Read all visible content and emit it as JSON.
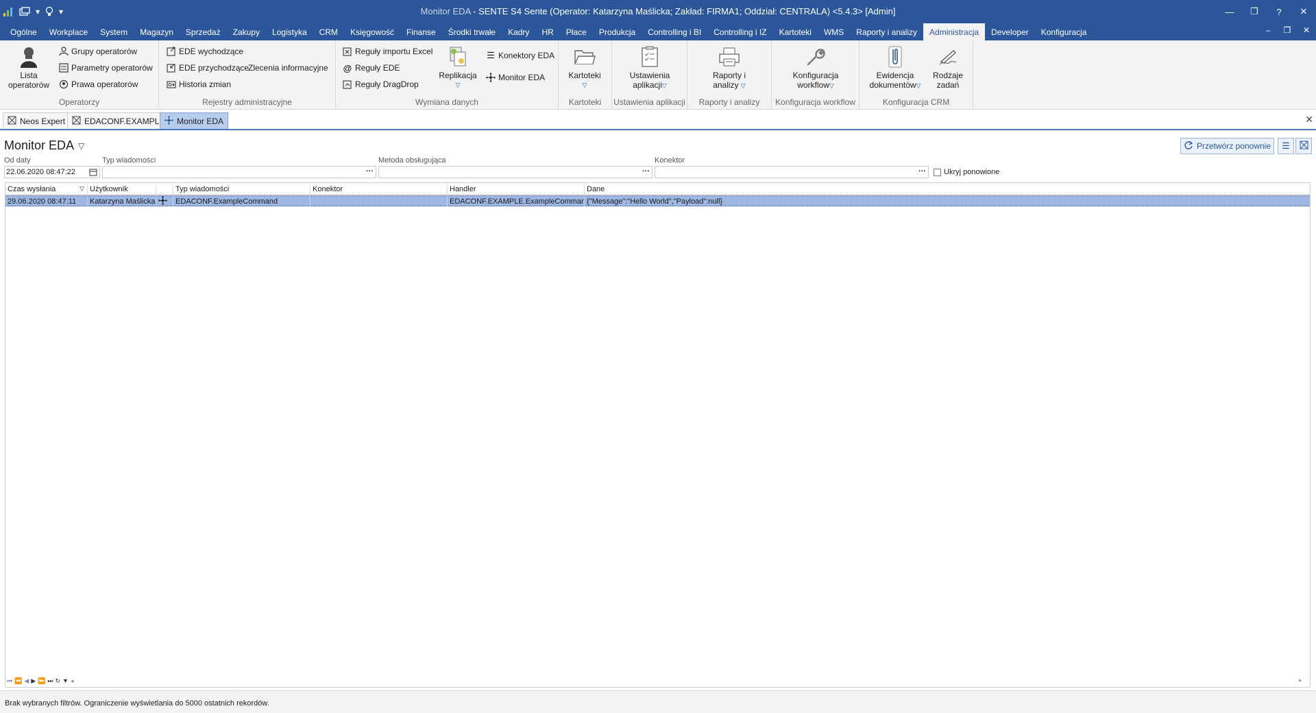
{
  "window": {
    "title_app": "Monitor EDA",
    "title_rest": " - SENTE S4 Sente (Operator: Katarzyna Maślicka; Zakład: FIRMA1; Oddział: CENTRALA) <5.4.3> [Admin]",
    "controls": [
      "—",
      "❐",
      "?",
      "✕"
    ]
  },
  "menu": {
    "tabs": [
      "Ogólne",
      "Workplace",
      "System",
      "Magazyn",
      "Sprzedaż",
      "Zakupy",
      "Logistyka",
      "CRM",
      "Księgowość",
      "Finanse",
      "Środki trwałe",
      "Kadry",
      "HR",
      "Płace",
      "Produkcja",
      "Controlling i BI",
      "Controlling i IZ",
      "Kartoteki",
      "WMS",
      "Raporty i analizy",
      "Administracja",
      "Developer",
      "Konfiguracja"
    ],
    "active": "Administracja"
  },
  "ribbon": {
    "operatorzy": {
      "label": "Operatorzy",
      "big": "Lista\noperatorów",
      "items": [
        "Grupy operatorów",
        "Parametry operatorów",
        "Prawa operatorów"
      ]
    },
    "rejestry": {
      "label": "Rejestry administracyjne",
      "items": [
        "EDE wychodzące",
        "EDE przychodzące",
        "Historia zmian"
      ],
      "extra": "Zlecenia informacyjne"
    },
    "wymiana": {
      "label": "Wymiana danych",
      "items": [
        "Reguły importu Excel",
        "Reguły EDE",
        "Reguły DragDrop"
      ],
      "replikacja": "Replikacja",
      "konektory": "Konektory EDA",
      "monitor": "Monitor EDA"
    },
    "kartoteki": {
      "label": "Kartoteki",
      "btn": "Kartoteki"
    },
    "ustawienia": {
      "label": "Ustawienia aplikacji",
      "btn1": "Ustawienia",
      "btn2": "aplikacji"
    },
    "raporty": {
      "label": "Raporty i analizy",
      "btn1": "Raporty i",
      "btn2": "analizy"
    },
    "workflow": {
      "label": "Konfiguracja workflow",
      "btn1": "Konfiguracja",
      "btn2": "workflow"
    },
    "crm": {
      "label": "Konfiguracja CRM",
      "ew1": "Ewidencja",
      "ew2": "dokumentów",
      "rz1": "Rodzaje",
      "rz2": "zadań"
    }
  },
  "doc_tabs": [
    "Neos Expert",
    "EDACONF.EXAMPLE",
    "Monitor EDA"
  ],
  "page": {
    "title": "Monitor EDA",
    "reprocess_button": "Przetwórz ponownie"
  },
  "filters": {
    "od_daty_label": "Od daty",
    "od_daty_value": "22.06.2020 08:47:22",
    "typ_label": "Typ wiadomości",
    "metoda_label": "Metoda obsługująca",
    "konektor_label": "Konektor",
    "hide_label": "Ukryj ponowione"
  },
  "table": {
    "columns": [
      "Czas wysłania",
      "Użytkownik",
      "",
      "Typ wiadomości",
      "Konektor",
      "Handler",
      "Dane"
    ],
    "rows": [
      [
        "29.06.2020 08:47:11",
        "Katarzyna Maślicka",
        "",
        "EDACONF.ExampleCommand",
        "",
        "EDACONF.EXAMPLE.ExampleCommand",
        "{\"Message\":\"Hello World\",\"Payload\":null}"
      ]
    ]
  },
  "status_text": "Brak wybranych filtrów. Ograniczenie wyświetlania do 5000 ostatnich rekordów.",
  "colors": {
    "accent": "#2b579a",
    "selection": "#9fb8e3",
    "ribbon_bg": "#f3f3f3"
  }
}
